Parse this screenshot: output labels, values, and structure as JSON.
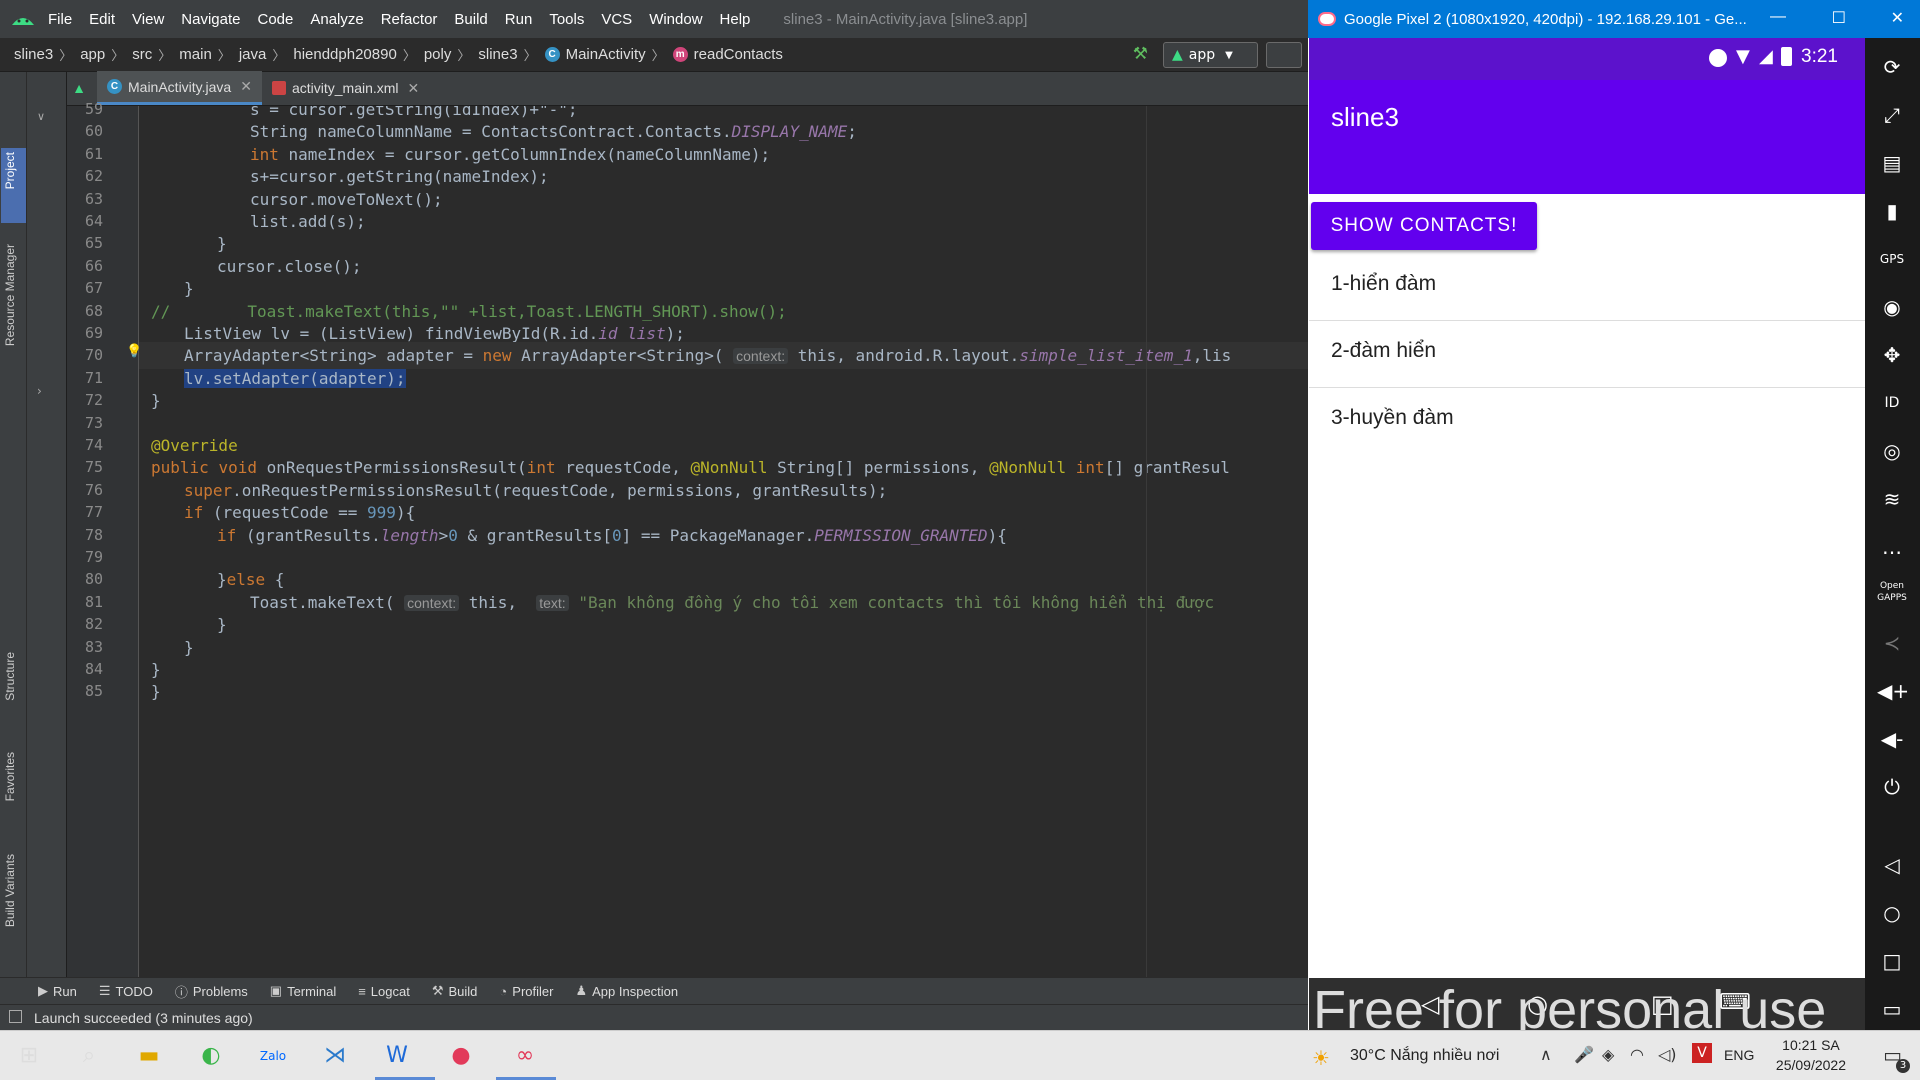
{
  "menubar": {
    "items": [
      "File",
      "Edit",
      "View",
      "Navigate",
      "Code",
      "Analyze",
      "Refactor",
      "Build",
      "Run",
      "Tools",
      "VCS",
      "Window",
      "Help"
    ],
    "title": "sline3 - MainActivity.java [sline3.app]"
  },
  "navbar": {
    "crumbs": [
      "sline3",
      "app",
      "src",
      "main",
      "java",
      "hienddph20890",
      "poly",
      "sline3",
      "MainActivity",
      "readContacts"
    ],
    "run_config": "app"
  },
  "left_strip": {
    "tabs": [
      "Project",
      "Resource Manager",
      "Structure",
      "Favorites",
      "Build Variants"
    ]
  },
  "editor_tabs": [
    {
      "label": "MainActivity.java",
      "active": true
    },
    {
      "label": "activity_main.xml",
      "active": false
    }
  ],
  "code": {
    "current_line": 70,
    "lines": [
      {
        "num": "59",
        "text": "s = cursor.getString(idIndex)+\"-\";"
      },
      {
        "num": "60",
        "text": "String nameColumnName = ContactsContract.Contacts.DISPLAY_NAME;"
      },
      {
        "num": "61",
        "text": "int nameIndex = cursor.getColumnIndex(nameColumnName);"
      },
      {
        "num": "62",
        "text": "s+=cursor.getString(nameIndex);"
      },
      {
        "num": "63",
        "text": "cursor.moveToNext();"
      },
      {
        "num": "64",
        "text": "list.add(s);"
      },
      {
        "num": "65",
        "text": "}"
      },
      {
        "num": "66",
        "text": "cursor.close();"
      },
      {
        "num": "67",
        "text": "}"
      },
      {
        "num": "68",
        "text": "//        Toast.makeText(this,\"\" +list,Toast.LENGTH_SHORT).show();"
      },
      {
        "num": "69",
        "text": "ListView lv = (ListView) findViewById(R.id.id_list);"
      },
      {
        "num": "70",
        "text": "ArrayAdapter<String> adapter = new ArrayAdapter<String>( context: this, android.R.layout.simple_list_item_1,lis"
      },
      {
        "num": "71",
        "text": "lv.setAdapter(adapter);"
      },
      {
        "num": "72",
        "text": "}"
      },
      {
        "num": "73",
        "text": ""
      },
      {
        "num": "74",
        "text": "@Override"
      },
      {
        "num": "75",
        "text": "public void onRequestPermissionsResult(int requestCode, @NonNull String[] permissions, @NonNull int[] grantResul"
      },
      {
        "num": "76",
        "text": "super.onRequestPermissionsResult(requestCode, permissions, grantResults);"
      },
      {
        "num": "77",
        "text": "if (requestCode == 999){"
      },
      {
        "num": "78",
        "text": "if (grantResults.length>0 & grantResults[0] == PackageManager.PERMISSION_GRANTED){"
      },
      {
        "num": "79",
        "text": ""
      },
      {
        "num": "80",
        "text": "}else {"
      },
      {
        "num": "81",
        "text": "Toast.makeText( context: this,  text: \"Bạn không đồng ý cho tôi xem contacts thì tôi không hiển thị được"
      },
      {
        "num": "82",
        "text": "}"
      },
      {
        "num": "83",
        "text": "}"
      },
      {
        "num": "84",
        "text": "}"
      },
      {
        "num": "85",
        "text": "}"
      }
    ]
  },
  "bottom_tabs": [
    "Run",
    "TODO",
    "Problems",
    "Terminal",
    "Logcat",
    "Build",
    "Profiler",
    "App Inspection"
  ],
  "status": "Launch succeeded (3 minutes ago)",
  "emulator": {
    "window_title": "Google Pixel 2 (1080x1920, 420dpi) - 192.168.29.101 - Ge...",
    "time": "3:21",
    "app_title": "sline3",
    "button_label": "SHOW CONTACTS!",
    "contacts": [
      "1-hiển đàm",
      "2-đàm hiển",
      "3-huyền đàm"
    ],
    "watermark": "Free for personal use"
  },
  "taskbar": {
    "weather": "30°C  Nắng nhiều nơi",
    "lang": "ENG",
    "time": "10:21 SA",
    "date": "25/09/2022",
    "notif_count": "3"
  },
  "colors": {
    "accent": "#6200ee",
    "ide_bg": "#2b2b2b",
    "keyword": "#cc7832",
    "field": "#9876aa"
  }
}
